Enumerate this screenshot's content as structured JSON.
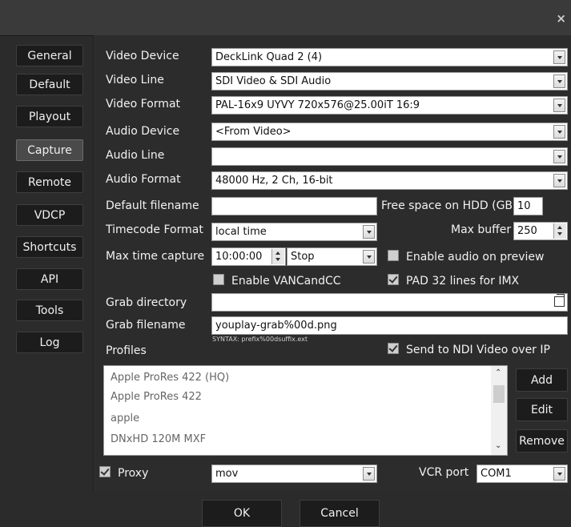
{
  "window": {
    "close_label": "×"
  },
  "sidebar": {
    "items": [
      {
        "label": "General"
      },
      {
        "label": "Default"
      },
      {
        "label": "Playout"
      },
      {
        "label": "Capture"
      },
      {
        "label": "Remote"
      },
      {
        "label": "VDCP"
      },
      {
        "label": "Shortcuts"
      },
      {
        "label": "API"
      },
      {
        "label": "Tools"
      },
      {
        "label": "Log"
      }
    ],
    "active": "Capture"
  },
  "capture": {
    "video_device": {
      "label": "Video Device",
      "value": "DeckLink Quad 2 (4)"
    },
    "video_line": {
      "label": "Video Line",
      "value": "SDI Video & SDI Audio"
    },
    "video_format": {
      "label": "Video Format",
      "value": "PAL-16x9 UYVY 720x576@25.00iT 16:9"
    },
    "audio_device": {
      "label": "Audio Device",
      "value": "<From Video>"
    },
    "audio_line": {
      "label": "Audio Line",
      "value": ""
    },
    "audio_format": {
      "label": "Audio Format",
      "value": "48000 Hz, 2 Ch, 16-bit"
    },
    "default_filename": {
      "label": "Default filename",
      "value": ""
    },
    "free_space": {
      "label": "Free space on HDD (GB)",
      "value": "10"
    },
    "timecode_format": {
      "label": "Timecode Format",
      "value": "local time"
    },
    "max_buffer": {
      "label": "Max buffer",
      "value": "250"
    },
    "max_time_capture": {
      "label": "Max time capture",
      "time": "10:00:00",
      "action": "Stop"
    },
    "enable_audio_preview": {
      "label": "Enable audio on preview",
      "checked": false
    },
    "enable_vanc": {
      "label": "Enable VANCandCC",
      "checked": false
    },
    "pad32": {
      "label": "PAD 32 lines for IMX",
      "checked": true
    },
    "grab_directory": {
      "label": "Grab directory",
      "value": ""
    },
    "grab_filename": {
      "label": "Grab filename",
      "value": "youplay-grab%00d.png"
    },
    "syntax_hint": "SYNTAX: prefix%00dsuffix.ext",
    "profiles_label": "Profiles",
    "send_ndi": {
      "label": "Send to NDI Video over IP",
      "checked": true
    },
    "profiles": [
      "Apple ProRes 422 (HQ)",
      "Apple ProRes 422",
      "apple",
      "DNxHD 120M MXF"
    ],
    "buttons": {
      "add": "Add",
      "edit": "Edit",
      "remove": "Remove"
    },
    "proxy": {
      "label": "Proxy",
      "checked": true,
      "format": "mov"
    },
    "vcr_port": {
      "label": "VCR port",
      "value": "COM1"
    }
  },
  "footer": {
    "ok": "OK",
    "cancel": "Cancel"
  }
}
